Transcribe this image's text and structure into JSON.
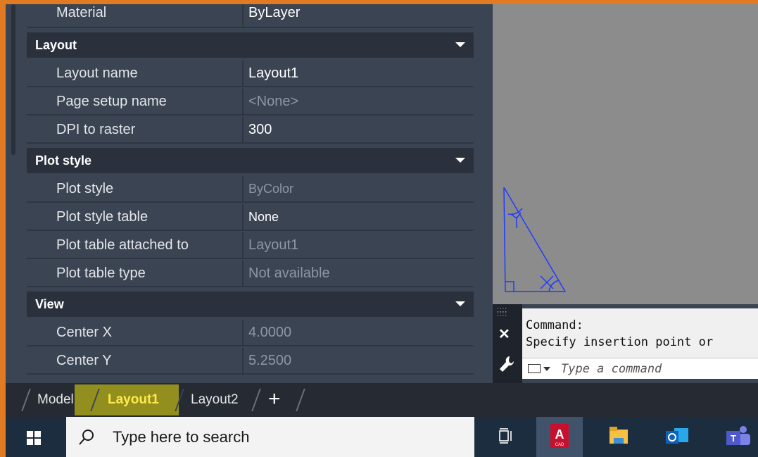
{
  "properties": {
    "partial_row": {
      "label": "Material",
      "value": "ByLayer"
    },
    "sections": [
      {
        "title": "Layout",
        "rows": [
          {
            "label": "Layout name",
            "value": "Layout1"
          },
          {
            "label": "Page setup name",
            "value": "<None>"
          },
          {
            "label": "DPI to raster",
            "value": "300"
          }
        ]
      },
      {
        "title": "Plot style",
        "rows": [
          {
            "label": "Plot style",
            "value": "ByColor"
          },
          {
            "label": "Plot style table",
            "value": "None"
          },
          {
            "label": "Plot table attached to",
            "value": "Layout1"
          },
          {
            "label": "Plot table type",
            "value": "Not available"
          }
        ]
      },
      {
        "title": "View",
        "rows": [
          {
            "label": "Center X",
            "value": "4.0000"
          },
          {
            "label": "Center Y",
            "value": "5.2500"
          }
        ]
      }
    ]
  },
  "command_window": {
    "history": [
      "Command:",
      "Specify insertion point or"
    ],
    "placeholder": "Type a command"
  },
  "layout_tabs": {
    "tabs": [
      "Model",
      "Layout1",
      "Layout2"
    ],
    "active": "Layout1",
    "add_symbol": "+"
  },
  "taskbar": {
    "search_placeholder": "Type here to search",
    "icons": [
      "task-view-icon",
      "autocad-icon",
      "file-explorer-icon",
      "outlook-icon",
      "teams-icon"
    ],
    "autocad_label": "A",
    "autocad_sublabel": "CAD"
  },
  "colors": {
    "window_border": "#e07b24",
    "panel_bg": "#3b4453",
    "drawing_bg": "#8c8c8c",
    "geometry": "#1f3bff",
    "active_tab": "#ffea4d"
  }
}
